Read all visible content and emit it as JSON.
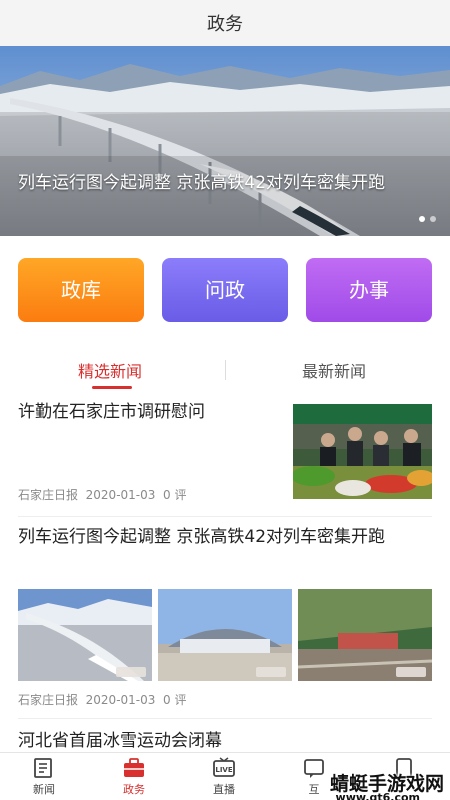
{
  "header": {
    "title": "政务"
  },
  "banner": {
    "caption": "列车运行图今起调整 京张高铁42对列车密集开跑"
  },
  "quick_actions": [
    {
      "label": "政库",
      "color": "#fb8a18"
    },
    {
      "label": "问政",
      "color": "#7a6cf0"
    },
    {
      "label": "办事",
      "color": "#b05cef"
    }
  ],
  "tabs": {
    "selected": "精选新闻",
    "other": "最新新闻",
    "accent": "#d8302f"
  },
  "articles": [
    {
      "title": "许勤在石家庄市调研慰问",
      "source": "石家庄日报",
      "date": "2020-01-03",
      "comments": "0 评"
    },
    {
      "title": "列车运行图今起调整 京张高铁42对列车密集开跑",
      "source": "石家庄日报",
      "date": "2020-01-03",
      "comments": "0 评"
    },
    {
      "title": "河北省首届冰雪运动会闭幕"
    }
  ],
  "bottom_nav": [
    {
      "label": "新闻",
      "icon": "news-icon"
    },
    {
      "label": "政务",
      "icon": "briefcase-icon",
      "active": true
    },
    {
      "label": "直播",
      "icon": "live-tv-icon"
    },
    {
      "label": "互",
      "icon": "interact-icon"
    }
  ],
  "watermark": {
    "text": "蜻蜓手游戏网",
    "url": "www.qt6.com"
  }
}
